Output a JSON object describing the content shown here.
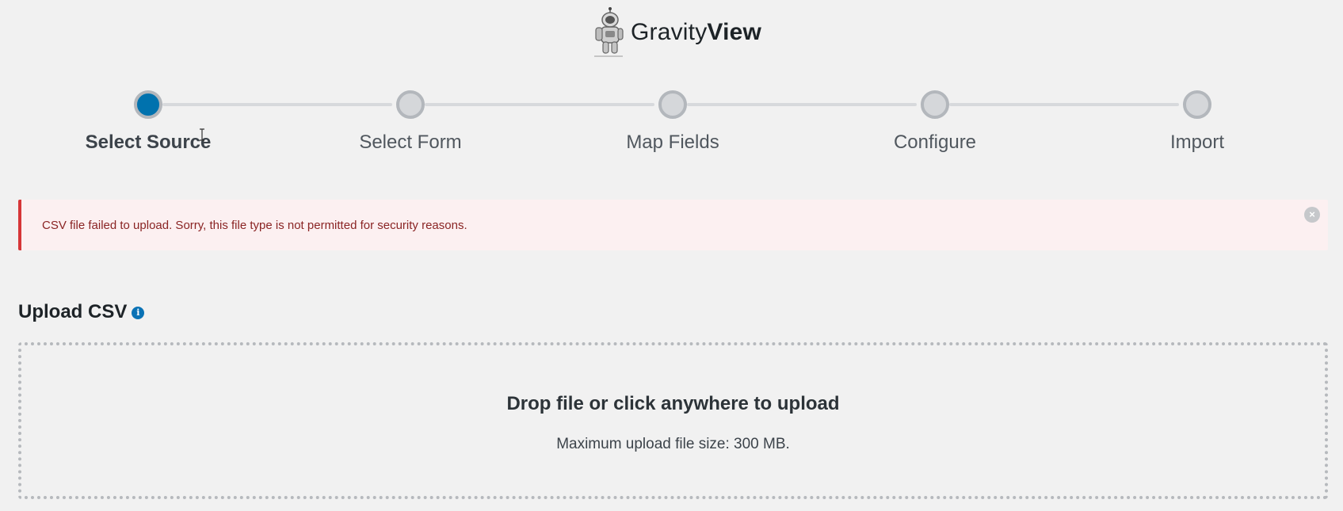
{
  "brand": {
    "name_light": "Gravity",
    "name_bold": "View"
  },
  "stepper": {
    "steps": [
      {
        "label": "Select Source",
        "active": true
      },
      {
        "label": "Select Form",
        "active": false
      },
      {
        "label": "Map Fields",
        "active": false
      },
      {
        "label": "Configure",
        "active": false
      },
      {
        "label": "Import",
        "active": false
      }
    ]
  },
  "notice": {
    "message": "CSV file failed to upload. Sorry, this file type is not permitted for security reasons.",
    "close_glyph": "×",
    "color": "#d63638"
  },
  "upload": {
    "title": "Upload CSV",
    "info_glyph": "i",
    "drop_text": "Drop file or click anywhere to upload",
    "max_size_text": "Maximum upload file size: 300 MB."
  },
  "colors": {
    "accent": "#0072ae",
    "background": "#f1f1f1"
  }
}
